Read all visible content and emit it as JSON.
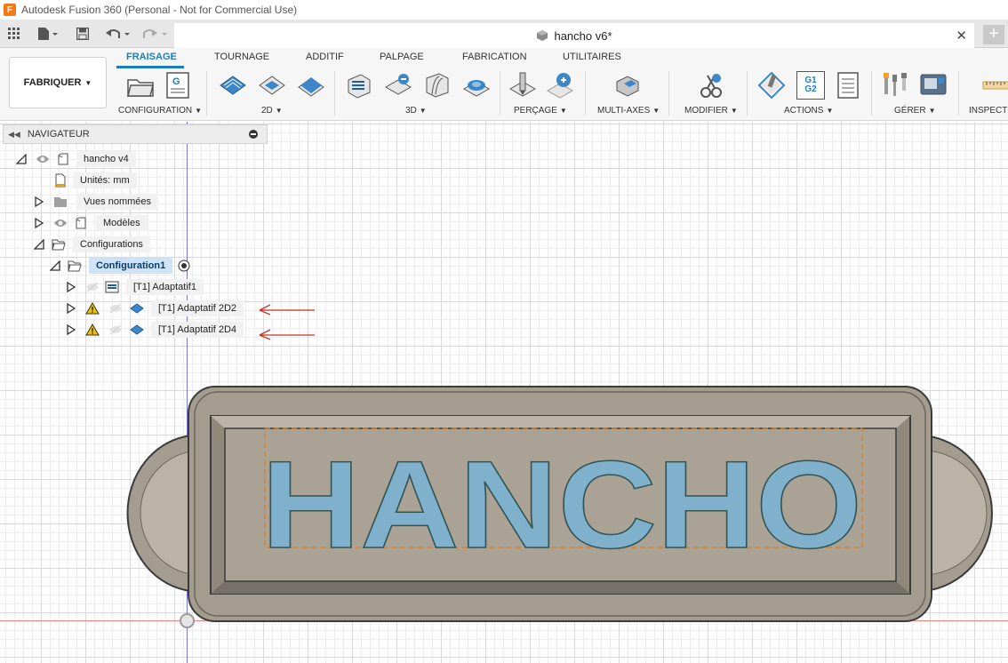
{
  "window": {
    "title": "Autodesk Fusion 360 (Personal - Not for Commercial Use)",
    "app_letter": "F"
  },
  "document": {
    "tab_title": "hancho v6*"
  },
  "ribbon": {
    "workspace": "FABRIQUER",
    "tabs": [
      "FRAISAGE",
      "TOURNAGE",
      "ADDITIF",
      "PALPAGE",
      "FABRICATION",
      "UTILITAIRES"
    ],
    "active_tab": "FRAISAGE",
    "groups": [
      "CONFIGURATION",
      "2D",
      "3D",
      "PERÇAGE",
      "MULTI-AXES",
      "MODIFIER",
      "ACTIONS",
      "GÉRER",
      "INSPECTI"
    ],
    "g1g2_lines": [
      "G1",
      "G2"
    ]
  },
  "navigator": {
    "title": "NAVIGATEUR",
    "root": "hancho v4",
    "units": "Unités: mm",
    "named_views": "Vues nommées",
    "models": "Modèles",
    "setups": "Configurations",
    "setup1": "Configuration1",
    "ops": [
      "[T1] Adaptatif1",
      "[T1] Adaptatif 2D2",
      "[T1] Adaptatif 2D4"
    ]
  },
  "model": {
    "text": "HANCHO"
  },
  "colors": {
    "accent": "#1a7ec1",
    "model_body": "#a49c8e",
    "model_text": "#7fb0cc",
    "warning": "#f2c200",
    "arrow": "#c0392b"
  }
}
